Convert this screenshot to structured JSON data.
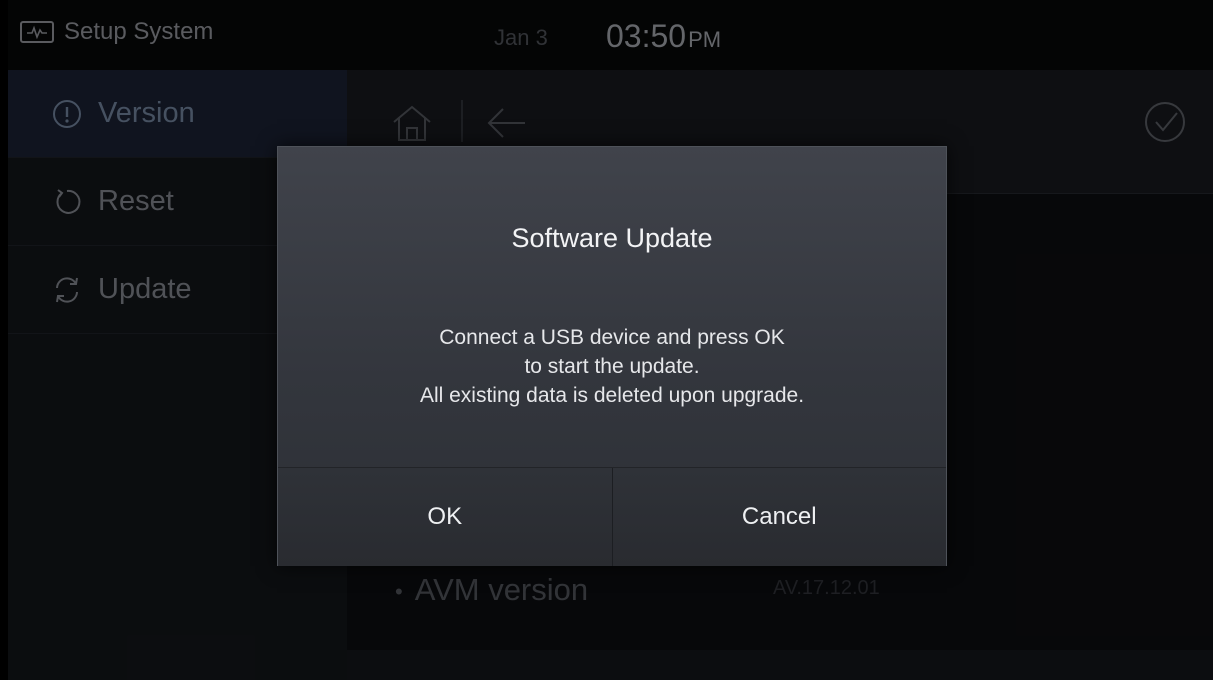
{
  "status_bar": {
    "app_title": "Setup System",
    "app_icon": "system-monitor-icon",
    "date": "Jan 3",
    "time": "03:50",
    "ampm": "PM"
  },
  "sidebar": {
    "items": [
      {
        "label": "Version",
        "icon": "info-circle-icon",
        "active": true
      },
      {
        "label": "Reset",
        "icon": "reset-icon",
        "active": false
      },
      {
        "label": "Update",
        "icon": "refresh-icon",
        "active": false
      }
    ]
  },
  "toolbar": {
    "home_icon": "home-icon",
    "back_icon": "back-arrow-icon",
    "confirm_icon": "check-circle-icon"
  },
  "content": {
    "rows": [
      {
        "label": "AVM version",
        "value": "AV.17.12.01"
      }
    ]
  },
  "dialog": {
    "title": "Software Update",
    "message_lines": [
      "Connect a USB device and press OK",
      "to start the update.",
      "All existing data is deleted upon upgrade."
    ],
    "ok_label": "OK",
    "cancel_label": "Cancel"
  },
  "colors": {
    "accent": "#6c7d95",
    "dialog_bg": "#393c43",
    "background": "#0b0c0f"
  }
}
